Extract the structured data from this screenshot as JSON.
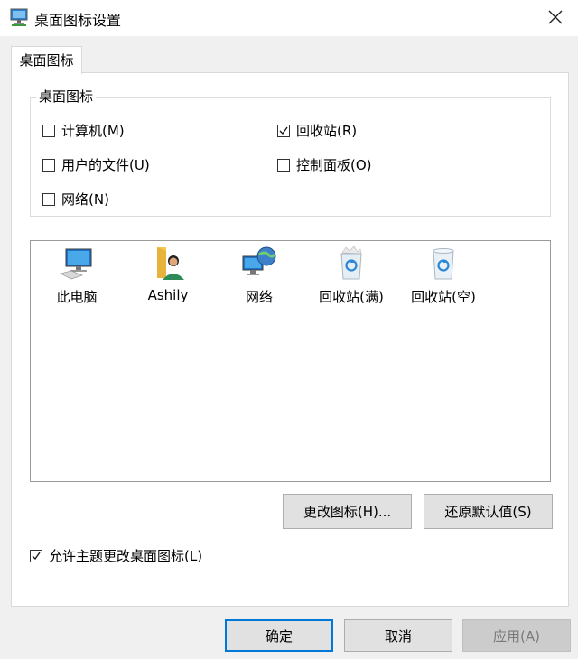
{
  "window": {
    "title": "桌面图标设置",
    "app_icon": "monitor-icon",
    "close_icon": "close-icon"
  },
  "tab": {
    "label": "桌面图标"
  },
  "group": {
    "legend": "桌面图标",
    "checkboxes": [
      {
        "label": "计算机(M)",
        "checked": false
      },
      {
        "label": "回收站(R)",
        "checked": true
      },
      {
        "label": "用户的文件(U)",
        "checked": false
      },
      {
        "label": "控制面板(O)",
        "checked": false
      },
      {
        "label": "网络(N)",
        "checked": false
      }
    ]
  },
  "icons": [
    {
      "label": "此电脑",
      "icon": "computer-icon"
    },
    {
      "label": "Ashily",
      "icon": "user-folder-icon"
    },
    {
      "label": "网络",
      "icon": "network-icon"
    },
    {
      "label": "回收站(满)",
      "icon": "recycle-bin-full-icon"
    },
    {
      "label": "回收站(空)",
      "icon": "recycle-bin-empty-icon"
    }
  ],
  "buttons": {
    "change_icon": "更改图标(H)...",
    "restore_default": "还原默认值(S)",
    "ok": "确定",
    "cancel": "取消",
    "apply": "应用(A)"
  },
  "allow_theme": {
    "label": "允许主题更改桌面图标(L)",
    "checked": true
  },
  "colors": {
    "accent": "#0078d7",
    "panel_bg": "#ffffff",
    "window_bg": "#f0f0f0"
  }
}
